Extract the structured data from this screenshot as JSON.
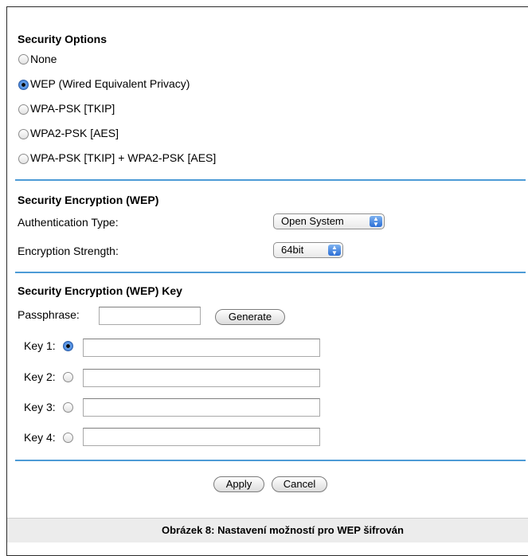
{
  "security_options": {
    "heading": "Security Options",
    "options": [
      {
        "label": "None",
        "selected": false
      },
      {
        "label": "WEP (Wired Equivalent Privacy)",
        "selected": true
      },
      {
        "label": "WPA-PSK [TKIP]",
        "selected": false
      },
      {
        "label": "WPA2-PSK [AES]",
        "selected": false
      },
      {
        "label": "WPA-PSK [TKIP] + WPA2-PSK [AES]",
        "selected": false
      }
    ]
  },
  "encryption": {
    "heading": "Security Encryption (WEP)",
    "auth_label": "Authentication Type:",
    "auth_value": "Open System",
    "strength_label": "Encryption Strength:",
    "strength_value": "64bit"
  },
  "wep_key": {
    "heading": "Security Encryption (WEP) Key",
    "passphrase_label": "Passphrase:",
    "passphrase_value": "",
    "generate_label": "Generate",
    "keys": [
      {
        "label": "Key 1:",
        "selected": true,
        "value": ""
      },
      {
        "label": "Key 2:",
        "selected": false,
        "value": ""
      },
      {
        "label": "Key 3:",
        "selected": false,
        "value": ""
      },
      {
        "label": "Key 4:",
        "selected": false,
        "value": ""
      }
    ]
  },
  "actions": {
    "apply_label": "Apply",
    "cancel_label": "Cancel"
  },
  "caption": "Obrázek 8: Nastavení možností pro WEP šifrován",
  "colors": {
    "accent_rule": "#4d9bd6",
    "radio_selected": "#2a6fd4",
    "caption_background": "#ececec"
  },
  "icons": {
    "select_arrows": "updown-arrows-icon"
  }
}
